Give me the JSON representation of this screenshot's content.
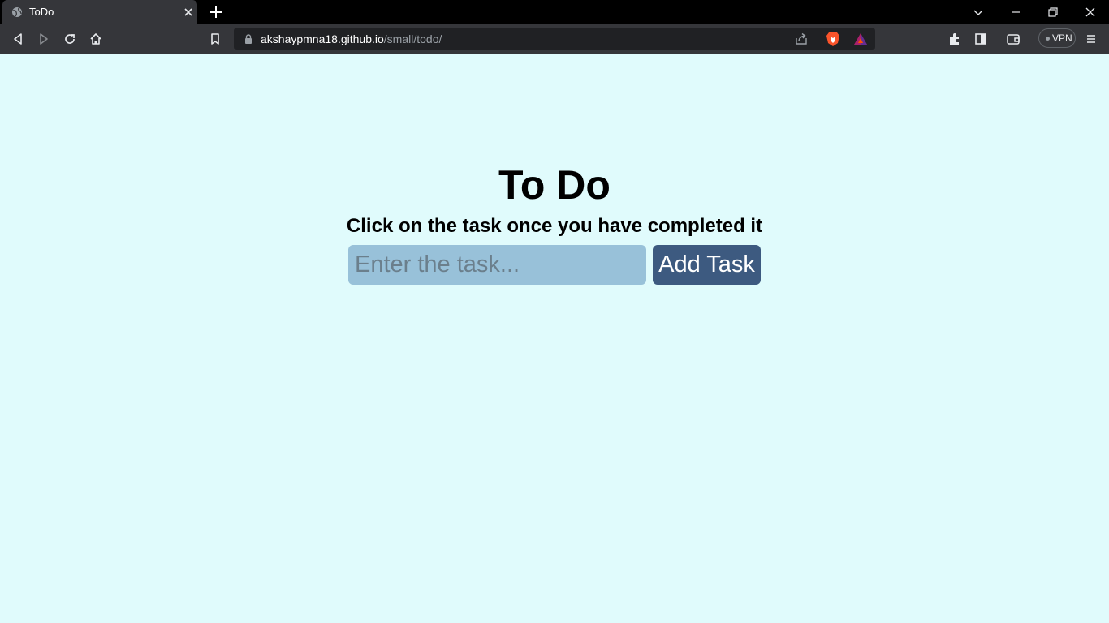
{
  "browser": {
    "tab": {
      "title": "ToDo"
    },
    "address_bar": {
      "host": "akshaypmna18.github.io",
      "path": "/small/todo/"
    },
    "vpn_label": "VPN"
  },
  "page": {
    "heading": "To Do",
    "subheading": "Click on the task once you have completed it",
    "task_input": {
      "placeholder": "Enter the task...",
      "value": ""
    },
    "add_button_label": "Add Task"
  },
  "colors": {
    "page_background": "#e0fbfc",
    "input_background": "#98c1d9",
    "button_background": "#3d5a80",
    "chrome_dark": "#35363a"
  },
  "icons": {
    "tab": [
      "globe-icon",
      "close-icon",
      "new-tab-icon"
    ],
    "window": [
      "tab-search-icon",
      "minimize-icon",
      "restore-icon",
      "window-close-icon"
    ],
    "toolbar": [
      "back-icon",
      "forward-icon",
      "reload-icon",
      "home-icon",
      "bookmark-icon",
      "lock-icon",
      "share-icon",
      "brave-shields-icon",
      "brave-rewards-icon",
      "extensions-icon",
      "sidebar-icon",
      "wallet-icon",
      "menu-icon"
    ]
  }
}
